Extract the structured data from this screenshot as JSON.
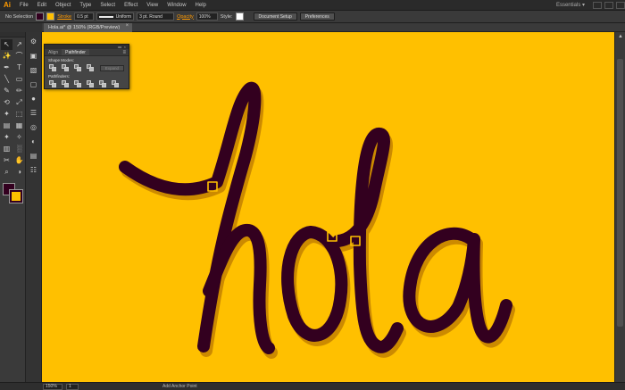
{
  "app": {
    "logo": "Ai",
    "workspace": "Essentials ▾"
  },
  "menu": [
    "File",
    "Edit",
    "Object",
    "Type",
    "Select",
    "Effect",
    "View",
    "Window",
    "Help"
  ],
  "control_bar": {
    "selection": "No Selection",
    "stroke_label": "Stroke",
    "stroke_value": "0.5 pt",
    "uniform": "Uniform",
    "round": "3 pt. Round",
    "opacity_label": "Opacity",
    "opacity_value": "100%",
    "style_label": "Style:",
    "doc_setup": "Document Setup",
    "preferences": "Preferences",
    "fill_color": "#33001f",
    "stroke_color": "#ffc000"
  },
  "document": {
    "tab_title": "Hola.ai* @ 150% (RGB/Preview)",
    "close": "×"
  },
  "pathfinder": {
    "tab_align": "Align",
    "tab_pathfinder": "Pathfinder",
    "menu": "≡",
    "shape_modes": "Shape Modes:",
    "pathfinders": "Pathfinders:",
    "expand": "Expand",
    "ctrl_collapse": "◂◂",
    "ctrl_close": "×"
  },
  "canvas": {
    "background": "#ffc000",
    "letter_color": "#33001f",
    "shadow_color": "#cc8a00",
    "text": "hola"
  },
  "toolbar": {
    "tools": [
      "↖",
      "↗",
      "✨",
      "⌒",
      "✒",
      "T",
      "╲",
      "▭",
      "✎",
      "✏",
      "⟲",
      "⤢",
      "✦",
      "⬚",
      "▤",
      "▦",
      "✦",
      "✧",
      "▥",
      "░",
      "✂",
      "✋",
      "⌕",
      "◑"
    ],
    "dock": [
      "⚙",
      "▣",
      "▧",
      "▢",
      "●",
      "☰",
      "◎",
      "◐",
      "▤",
      "☷"
    ]
  },
  "status": {
    "zoom": "150%",
    "page": "1",
    "tool_hint": "Add Anchor Point"
  }
}
